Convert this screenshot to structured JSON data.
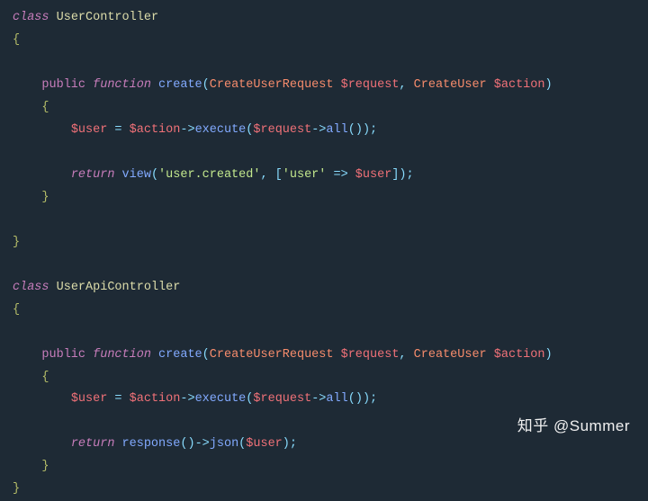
{
  "code": {
    "class1": {
      "keyword_class": "class",
      "name": "UserController",
      "brace_open": "{",
      "brace_close": "}",
      "method": {
        "keyword_public": "public",
        "keyword_function": "function",
        "name": "create",
        "paren_open": "(",
        "paren_close": ")",
        "param1_type": "CreateUserRequest",
        "param1_var": "$request",
        "comma": ",",
        "param2_type": "CreateUser",
        "param2_var": "$action",
        "body_open": "{",
        "body_close": "}",
        "line1": {
          "var_user": "$user",
          "op_assign": " = ",
          "var_action": "$action",
          "arrow1": "->",
          "fn_execute": "execute",
          "paren_open": "(",
          "var_request": "$request",
          "arrow2": "->",
          "fn_all": "all",
          "paren_inner_open": "(",
          "paren_inner_close": ")",
          "paren_close": ")",
          "semi": ";"
        },
        "line2": {
          "keyword_return": "return",
          "fn_view": "view",
          "paren_open": "(",
          "str_view": "'user.created'",
          "comma": ", ",
          "bracket_open": "[",
          "str_key": "'user'",
          "arrow": " => ",
          "var_user": "$user",
          "bracket_close": "]",
          "paren_close": ")",
          "semi": ";"
        }
      }
    },
    "class2": {
      "keyword_class": "class",
      "name": "UserApiController",
      "brace_open": "{",
      "brace_close": "}",
      "method": {
        "keyword_public": "public",
        "keyword_function": "function",
        "name": "create",
        "paren_open": "(",
        "paren_close": ")",
        "param1_type": "CreateUserRequest",
        "param1_var": "$request",
        "comma": ",",
        "param2_type": "CreateUser",
        "param2_var": "$action",
        "body_open": "{",
        "body_close": "}",
        "line1": {
          "var_user": "$user",
          "op_assign": " = ",
          "var_action": "$action",
          "arrow1": "->",
          "fn_execute": "execute",
          "paren_open": "(",
          "var_request": "$request",
          "arrow2": "->",
          "fn_all": "all",
          "paren_inner_open": "(",
          "paren_inner_close": ")",
          "paren_close": ")",
          "semi": ";"
        },
        "line2": {
          "keyword_return": "return",
          "fn_response": "response",
          "paren1_open": "(",
          "paren1_close": ")",
          "arrow": "->",
          "fn_json": "json",
          "paren2_open": "(",
          "var_user": "$user",
          "paren2_close": ")",
          "semi": ";"
        }
      }
    }
  },
  "watermark": "知乎 @Summer"
}
